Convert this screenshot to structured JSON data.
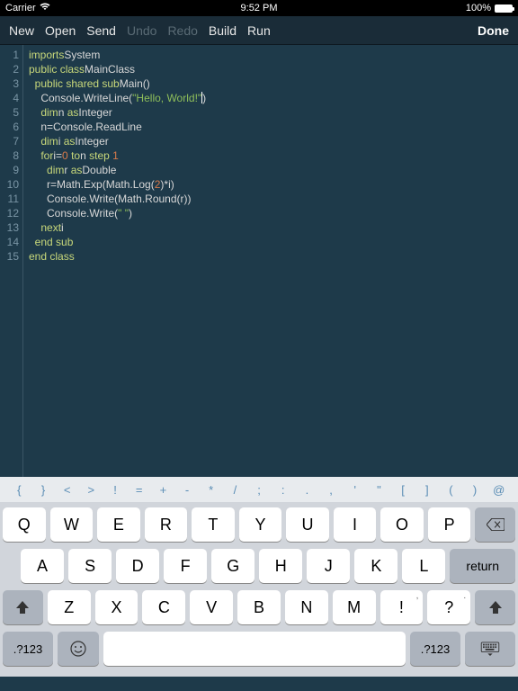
{
  "status": {
    "carrier": "Carrier",
    "time": "9:52 PM",
    "battery": "100%"
  },
  "toolbar": {
    "new": "New",
    "open": "Open",
    "send": "Send",
    "undo": "Undo",
    "redo": "Redo",
    "build": "Build",
    "run": "Run",
    "done": "Done"
  },
  "code": {
    "lines": [
      {
        "n": "1",
        "t": [
          [
            "kw",
            "imports"
          ],
          [
            " ",
            "System"
          ]
        ]
      },
      {
        "n": "2",
        "t": [
          [
            "kw",
            "public class"
          ],
          [
            " ",
            "MainClass"
          ]
        ]
      },
      {
        "n": "3",
        "t": [
          [
            "",
            "  "
          ],
          [
            "kw",
            "public shared sub"
          ],
          [
            " ",
            "Main()"
          ]
        ]
      },
      {
        "n": "4",
        "t": [
          [
            "",
            "    Console.WriteLine("
          ],
          [
            "str",
            "\"Hello, World!\""
          ],
          [
            "",
            ")"
          ]
        ],
        "cursor": true,
        "cursor_after": 2
      },
      {
        "n": "5",
        "t": [
          [
            "",
            "    "
          ],
          [
            "kw",
            "dim"
          ],
          [
            " ",
            "n "
          ],
          [
            "kw",
            "as"
          ],
          [
            " ",
            "Integer"
          ]
        ]
      },
      {
        "n": "6",
        "t": [
          [
            "",
            "    n=Console.ReadLine"
          ]
        ]
      },
      {
        "n": "7",
        "t": [
          [
            "",
            "    "
          ],
          [
            "kw",
            "dim"
          ],
          [
            " ",
            "i "
          ],
          [
            "kw",
            "as"
          ],
          [
            " ",
            "Integer"
          ]
        ]
      },
      {
        "n": "8",
        "t": [
          [
            "",
            "    "
          ],
          [
            "kw",
            "for"
          ],
          [
            " ",
            "i="
          ],
          [
            "num",
            "0"
          ],
          [
            " ",
            " "
          ],
          [
            "kw",
            "to"
          ],
          [
            " ",
            "n "
          ],
          [
            "kw",
            "step"
          ],
          [
            " ",
            " "
          ],
          [
            "num",
            "1"
          ]
        ]
      },
      {
        "n": "9",
        "t": [
          [
            "",
            "      "
          ],
          [
            "kw",
            "dim"
          ],
          [
            " ",
            "r "
          ],
          [
            "kw",
            "as"
          ],
          [
            " ",
            "Double"
          ]
        ]
      },
      {
        "n": "10",
        "t": [
          [
            "",
            "      r=Math.Exp(Math.Log("
          ],
          [
            "num",
            "2"
          ],
          [
            "",
            ")*i)"
          ]
        ]
      },
      {
        "n": "11",
        "t": [
          [
            "",
            "      Console.Write(Math.Round(r))"
          ]
        ]
      },
      {
        "n": "12",
        "t": [
          [
            "",
            "      Console.Write("
          ],
          [
            "str",
            "\" \""
          ],
          [
            "",
            ")"
          ]
        ]
      },
      {
        "n": "13",
        "t": [
          [
            "",
            "    "
          ],
          [
            "kw",
            "next"
          ],
          [
            " ",
            "i"
          ]
        ]
      },
      {
        "n": "14",
        "t": [
          [
            "",
            "  "
          ],
          [
            "kw",
            "end sub"
          ]
        ]
      },
      {
        "n": "15",
        "t": [
          [
            "kw",
            "end class"
          ]
        ]
      }
    ]
  },
  "symbols": [
    "{",
    "}",
    "<",
    ">",
    "!",
    "=",
    "+",
    "-",
    "*",
    "/",
    ";",
    ":",
    ".",
    ",",
    "'",
    "\"",
    "[",
    "]",
    "(",
    ")",
    "@"
  ],
  "keyboard": {
    "row1": [
      "Q",
      "W",
      "E",
      "R",
      "T",
      "Y",
      "U",
      "I",
      "O",
      "P"
    ],
    "row2": [
      "A",
      "S",
      "D",
      "F",
      "G",
      "H",
      "J",
      "K",
      "L"
    ],
    "row3": [
      "Z",
      "X",
      "C",
      "V",
      "B",
      "N",
      "M"
    ],
    "row3_punct": [
      {
        "main": "!",
        "sub": ","
      },
      {
        "main": "?",
        "sub": "."
      }
    ],
    "return": "return",
    "mode": ".?123"
  }
}
